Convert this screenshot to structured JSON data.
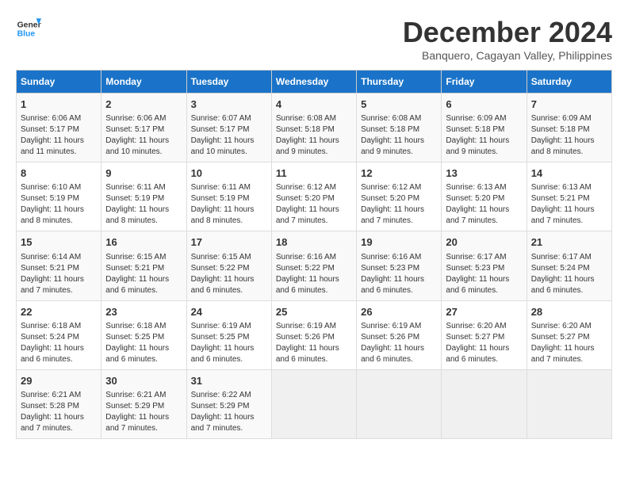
{
  "header": {
    "logo_line1": "General",
    "logo_line2": "Blue",
    "month_title": "December 2024",
    "subtitle": "Banquero, Cagayan Valley, Philippines"
  },
  "days_of_week": [
    "Sunday",
    "Monday",
    "Tuesday",
    "Wednesday",
    "Thursday",
    "Friday",
    "Saturday"
  ],
  "weeks": [
    [
      {
        "day": "1",
        "lines": [
          "Sunrise: 6:06 AM",
          "Sunset: 5:17 PM",
          "Daylight: 11 hours",
          "and 11 minutes."
        ]
      },
      {
        "day": "2",
        "lines": [
          "Sunrise: 6:06 AM",
          "Sunset: 5:17 PM",
          "Daylight: 11 hours",
          "and 10 minutes."
        ]
      },
      {
        "day": "3",
        "lines": [
          "Sunrise: 6:07 AM",
          "Sunset: 5:17 PM",
          "Daylight: 11 hours",
          "and 10 minutes."
        ]
      },
      {
        "day": "4",
        "lines": [
          "Sunrise: 6:08 AM",
          "Sunset: 5:18 PM",
          "Daylight: 11 hours",
          "and 9 minutes."
        ]
      },
      {
        "day": "5",
        "lines": [
          "Sunrise: 6:08 AM",
          "Sunset: 5:18 PM",
          "Daylight: 11 hours",
          "and 9 minutes."
        ]
      },
      {
        "day": "6",
        "lines": [
          "Sunrise: 6:09 AM",
          "Sunset: 5:18 PM",
          "Daylight: 11 hours",
          "and 9 minutes."
        ]
      },
      {
        "day": "7",
        "lines": [
          "Sunrise: 6:09 AM",
          "Sunset: 5:18 PM",
          "Daylight: 11 hours",
          "and 8 minutes."
        ]
      }
    ],
    [
      {
        "day": "8",
        "lines": [
          "Sunrise: 6:10 AM",
          "Sunset: 5:19 PM",
          "Daylight: 11 hours",
          "and 8 minutes."
        ]
      },
      {
        "day": "9",
        "lines": [
          "Sunrise: 6:11 AM",
          "Sunset: 5:19 PM",
          "Daylight: 11 hours",
          "and 8 minutes."
        ]
      },
      {
        "day": "10",
        "lines": [
          "Sunrise: 6:11 AM",
          "Sunset: 5:19 PM",
          "Daylight: 11 hours",
          "and 8 minutes."
        ]
      },
      {
        "day": "11",
        "lines": [
          "Sunrise: 6:12 AM",
          "Sunset: 5:20 PM",
          "Daylight: 11 hours",
          "and 7 minutes."
        ]
      },
      {
        "day": "12",
        "lines": [
          "Sunrise: 6:12 AM",
          "Sunset: 5:20 PM",
          "Daylight: 11 hours",
          "and 7 minutes."
        ]
      },
      {
        "day": "13",
        "lines": [
          "Sunrise: 6:13 AM",
          "Sunset: 5:20 PM",
          "Daylight: 11 hours",
          "and 7 minutes."
        ]
      },
      {
        "day": "14",
        "lines": [
          "Sunrise: 6:13 AM",
          "Sunset: 5:21 PM",
          "Daylight: 11 hours",
          "and 7 minutes."
        ]
      }
    ],
    [
      {
        "day": "15",
        "lines": [
          "Sunrise: 6:14 AM",
          "Sunset: 5:21 PM",
          "Daylight: 11 hours",
          "and 7 minutes."
        ]
      },
      {
        "day": "16",
        "lines": [
          "Sunrise: 6:15 AM",
          "Sunset: 5:21 PM",
          "Daylight: 11 hours",
          "and 6 minutes."
        ]
      },
      {
        "day": "17",
        "lines": [
          "Sunrise: 6:15 AM",
          "Sunset: 5:22 PM",
          "Daylight: 11 hours",
          "and 6 minutes."
        ]
      },
      {
        "day": "18",
        "lines": [
          "Sunrise: 6:16 AM",
          "Sunset: 5:22 PM",
          "Daylight: 11 hours",
          "and 6 minutes."
        ]
      },
      {
        "day": "19",
        "lines": [
          "Sunrise: 6:16 AM",
          "Sunset: 5:23 PM",
          "Daylight: 11 hours",
          "and 6 minutes."
        ]
      },
      {
        "day": "20",
        "lines": [
          "Sunrise: 6:17 AM",
          "Sunset: 5:23 PM",
          "Daylight: 11 hours",
          "and 6 minutes."
        ]
      },
      {
        "day": "21",
        "lines": [
          "Sunrise: 6:17 AM",
          "Sunset: 5:24 PM",
          "Daylight: 11 hours",
          "and 6 minutes."
        ]
      }
    ],
    [
      {
        "day": "22",
        "lines": [
          "Sunrise: 6:18 AM",
          "Sunset: 5:24 PM",
          "Daylight: 11 hours",
          "and 6 minutes."
        ]
      },
      {
        "day": "23",
        "lines": [
          "Sunrise: 6:18 AM",
          "Sunset: 5:25 PM",
          "Daylight: 11 hours",
          "and 6 minutes."
        ]
      },
      {
        "day": "24",
        "lines": [
          "Sunrise: 6:19 AM",
          "Sunset: 5:25 PM",
          "Daylight: 11 hours",
          "and 6 minutes."
        ]
      },
      {
        "day": "25",
        "lines": [
          "Sunrise: 6:19 AM",
          "Sunset: 5:26 PM",
          "Daylight: 11 hours",
          "and 6 minutes."
        ]
      },
      {
        "day": "26",
        "lines": [
          "Sunrise: 6:19 AM",
          "Sunset: 5:26 PM",
          "Daylight: 11 hours",
          "and 6 minutes."
        ]
      },
      {
        "day": "27",
        "lines": [
          "Sunrise: 6:20 AM",
          "Sunset: 5:27 PM",
          "Daylight: 11 hours",
          "and 6 minutes."
        ]
      },
      {
        "day": "28",
        "lines": [
          "Sunrise: 6:20 AM",
          "Sunset: 5:27 PM",
          "Daylight: 11 hours",
          "and 7 minutes."
        ]
      }
    ],
    [
      {
        "day": "29",
        "lines": [
          "Sunrise: 6:21 AM",
          "Sunset: 5:28 PM",
          "Daylight: 11 hours",
          "and 7 minutes."
        ]
      },
      {
        "day": "30",
        "lines": [
          "Sunrise: 6:21 AM",
          "Sunset: 5:29 PM",
          "Daylight: 11 hours",
          "and 7 minutes."
        ]
      },
      {
        "day": "31",
        "lines": [
          "Sunrise: 6:22 AM",
          "Sunset: 5:29 PM",
          "Daylight: 11 hours",
          "and 7 minutes."
        ]
      },
      {
        "day": "",
        "lines": []
      },
      {
        "day": "",
        "lines": []
      },
      {
        "day": "",
        "lines": []
      },
      {
        "day": "",
        "lines": []
      }
    ]
  ]
}
